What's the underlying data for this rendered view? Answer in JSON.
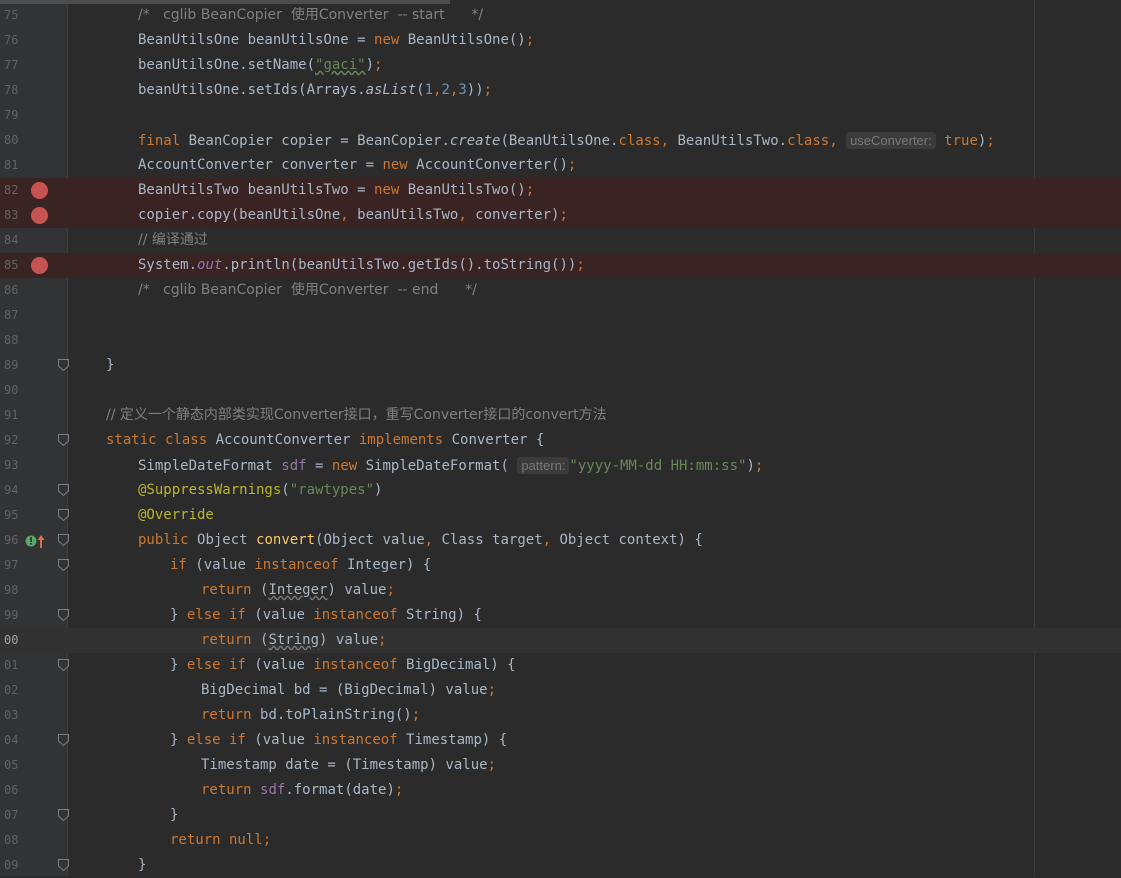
{
  "editor": {
    "lines": [
      {
        "no": "75",
        "indent": 2,
        "tokens": [
          [
            "c",
            "/*   cglib BeanCopier  使用Converter  -- start      */"
          ]
        ]
      },
      {
        "no": "76",
        "indent": 2,
        "tokens": [
          [
            "t",
            "BeanUtilsOne beanUtilsOne = "
          ],
          [
            "k",
            "new "
          ],
          [
            "t",
            "BeanUtilsOne()"
          ],
          [
            "k",
            ";"
          ]
        ]
      },
      {
        "no": "77",
        "indent": 2,
        "tokens": [
          [
            "t",
            "beanUtilsOne.setName("
          ],
          [
            "wg",
            "\"gaci\""
          ],
          [
            "t",
            ")"
          ],
          [
            "k",
            ";"
          ]
        ]
      },
      {
        "no": "78",
        "indent": 2,
        "tokens": [
          [
            "t",
            "beanUtilsOne.setIds(Arrays."
          ],
          [
            "it",
            "asList"
          ],
          [
            "t",
            "("
          ],
          [
            "n",
            "1"
          ],
          [
            "k",
            ","
          ],
          [
            "n",
            "2"
          ],
          [
            "k",
            ","
          ],
          [
            "n",
            "3"
          ],
          [
            "t",
            "))"
          ],
          [
            "k",
            ";"
          ]
        ]
      },
      {
        "no": "79",
        "indent": 2,
        "tokens": []
      },
      {
        "no": "80",
        "indent": 2,
        "tokens": [
          [
            "k",
            "final "
          ],
          [
            "t",
            "BeanCopier copier = BeanCopier."
          ],
          [
            "it",
            "create"
          ],
          [
            "t",
            "(BeanUtilsOne."
          ],
          [
            "k",
            "class, "
          ],
          [
            "t",
            "BeanUtilsTwo."
          ],
          [
            "k",
            "class, "
          ],
          [
            "h",
            "useConverter:"
          ],
          [
            "k",
            " true"
          ],
          [
            "t",
            ")"
          ],
          [
            "k",
            ";"
          ]
        ]
      },
      {
        "no": "81",
        "indent": 2,
        "tokens": [
          [
            "t",
            "AccountConverter converter = "
          ],
          [
            "k",
            "new "
          ],
          [
            "t",
            "AccountConverter()"
          ],
          [
            "k",
            ";"
          ]
        ]
      },
      {
        "no": "82",
        "indent": 2,
        "bp": true,
        "tokens": [
          [
            "t",
            "BeanUtilsTwo beanUtilsTwo = "
          ],
          [
            "k",
            "new "
          ],
          [
            "t",
            "BeanUtilsTwo()"
          ],
          [
            "k",
            ";"
          ]
        ]
      },
      {
        "no": "83",
        "indent": 2,
        "bp": true,
        "tokens": [
          [
            "t",
            "copier.copy(beanUtilsOne"
          ],
          [
            "k",
            ", "
          ],
          [
            "t",
            "beanUtilsTwo"
          ],
          [
            "k",
            ", "
          ],
          [
            "t",
            "converter)"
          ],
          [
            "k",
            ";"
          ]
        ]
      },
      {
        "no": "84",
        "indent": 2,
        "tokens": [
          [
            "c",
            "// 编译通过"
          ]
        ]
      },
      {
        "no": "85",
        "indent": 2,
        "bp": true,
        "tokens": [
          [
            "t",
            "System."
          ],
          [
            "fi",
            "out"
          ],
          [
            "t",
            ".println(beanUtilsTwo.getIds().toString())"
          ],
          [
            "k",
            ";"
          ]
        ]
      },
      {
        "no": "86",
        "indent": 2,
        "tokens": [
          [
            "c",
            "/*   cglib BeanCopier  使用Converter  -- end      */"
          ]
        ]
      },
      {
        "no": "87",
        "indent": 2,
        "tokens": []
      },
      {
        "no": "88",
        "indent": 2,
        "tokens": []
      },
      {
        "no": "89",
        "indent": 1,
        "fold": true,
        "tokens": [
          [
            "t",
            "}"
          ]
        ]
      },
      {
        "no": "90",
        "indent": 1,
        "tokens": []
      },
      {
        "no": "91",
        "indent": 1,
        "tokens": [
          [
            "c",
            "// 定义一个静态内部类实现Converter接口，重写Converter接口的convert方法"
          ]
        ]
      },
      {
        "no": "92",
        "indent": 1,
        "fold": true,
        "tokens": [
          [
            "k",
            "static class "
          ],
          [
            "t",
            "AccountConverter "
          ],
          [
            "k",
            "implements "
          ],
          [
            "t",
            "Converter {"
          ]
        ]
      },
      {
        "no": "93",
        "indent": 2,
        "tokens": [
          [
            "t",
            "SimpleDateFormat "
          ],
          [
            "f",
            "sdf"
          ],
          [
            "t",
            " = "
          ],
          [
            "k",
            "new "
          ],
          [
            "t",
            "SimpleDateFormat( "
          ],
          [
            "h",
            "pattern:"
          ],
          [
            "s",
            "\"yyyy-MM-dd HH:mm:ss\""
          ],
          [
            "t",
            ")"
          ],
          [
            "k",
            ";"
          ]
        ]
      },
      {
        "no": "94",
        "indent": 2,
        "fold": true,
        "tokens": [
          [
            "a",
            "@SuppressWarnings"
          ],
          [
            "t",
            "("
          ],
          [
            "s",
            "\"rawtypes\""
          ],
          [
            "t",
            ")"
          ]
        ]
      },
      {
        "no": "95",
        "indent": 2,
        "fold": true,
        "tokens": [
          [
            "a",
            "@Override"
          ]
        ]
      },
      {
        "no": "96",
        "indent": 2,
        "fold": true,
        "impl": true,
        "tokens": [
          [
            "k",
            "public "
          ],
          [
            "t",
            "Object "
          ],
          [
            "m",
            "convert"
          ],
          [
            "t",
            "(Object value"
          ],
          [
            "k",
            ", "
          ],
          [
            "t",
            "Class target"
          ],
          [
            "k",
            ", "
          ],
          [
            "t",
            "Object context) {"
          ]
        ]
      },
      {
        "no": "97",
        "indent": 3,
        "fold": true,
        "tokens": [
          [
            "k",
            "if "
          ],
          [
            "t",
            "(value "
          ],
          [
            "k",
            "instanceof "
          ],
          [
            "t",
            "Integer) {"
          ]
        ]
      },
      {
        "no": "98",
        "indent": 4,
        "tokens": [
          [
            "k",
            "return "
          ],
          [
            "t",
            "("
          ],
          [
            "w",
            "Integer"
          ],
          [
            "t",
            ") value"
          ],
          [
            "k",
            ";"
          ]
        ]
      },
      {
        "no": "99",
        "indent": 3,
        "fold": true,
        "tokens": [
          [
            "t",
            "} "
          ],
          [
            "k",
            "else if "
          ],
          [
            "t",
            "(value "
          ],
          [
            "k",
            "instanceof "
          ],
          [
            "t",
            "String) {"
          ]
        ]
      },
      {
        "no": "00",
        "indent": 4,
        "caret": true,
        "tokens": [
          [
            "k",
            "return "
          ],
          [
            "t",
            "("
          ],
          [
            "w",
            "String"
          ],
          [
            "t",
            ") value"
          ],
          [
            "k",
            ";"
          ]
        ]
      },
      {
        "no": "01",
        "indent": 3,
        "fold": true,
        "tokens": [
          [
            "t",
            "} "
          ],
          [
            "k",
            "else if "
          ],
          [
            "t",
            "(value "
          ],
          [
            "k",
            "instanceof "
          ],
          [
            "t",
            "BigDecimal) {"
          ]
        ]
      },
      {
        "no": "02",
        "indent": 4,
        "tokens": [
          [
            "t",
            "BigDecimal bd = (BigDecimal) value"
          ],
          [
            "k",
            ";"
          ]
        ]
      },
      {
        "no": "03",
        "indent": 4,
        "tokens": [
          [
            "k",
            "return "
          ],
          [
            "t",
            "bd.toPlainString()"
          ],
          [
            "k",
            ";"
          ]
        ]
      },
      {
        "no": "04",
        "indent": 3,
        "fold": true,
        "tokens": [
          [
            "t",
            "} "
          ],
          [
            "k",
            "else if "
          ],
          [
            "t",
            "(value "
          ],
          [
            "k",
            "instanceof "
          ],
          [
            "t",
            "Timestamp) {"
          ]
        ]
      },
      {
        "no": "05",
        "indent": 4,
        "tokens": [
          [
            "t",
            "Timestamp date = (Timestamp) value"
          ],
          [
            "k",
            ";"
          ]
        ]
      },
      {
        "no": "06",
        "indent": 4,
        "tokens": [
          [
            "k",
            "return "
          ],
          [
            "f",
            "sdf"
          ],
          [
            "t",
            ".format(date)"
          ],
          [
            "k",
            ";"
          ]
        ]
      },
      {
        "no": "07",
        "indent": 3,
        "fold": true,
        "tokens": [
          [
            "t",
            "}"
          ]
        ]
      },
      {
        "no": "08",
        "indent": 3,
        "tokens": [
          [
            "k",
            "return null;"
          ]
        ]
      },
      {
        "no": "09",
        "indent": 2,
        "fold": true,
        "tokens": [
          [
            "t",
            "}"
          ]
        ]
      }
    ]
  }
}
